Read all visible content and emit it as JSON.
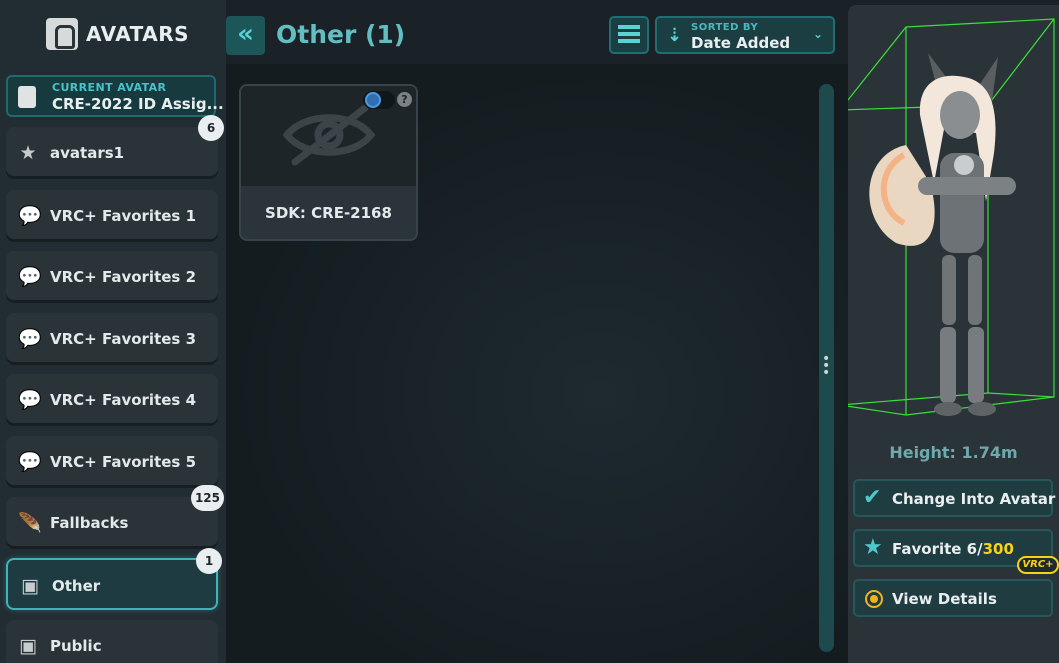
{
  "app": {
    "title": "AVATARS"
  },
  "current_avatar": {
    "label": "CURRENT AVATAR",
    "name": "CRE-2022 ID Assig..."
  },
  "sidebar": {
    "items": [
      {
        "label": "avatars1",
        "icon": "star-icon",
        "badge": "6",
        "selected": false
      },
      {
        "label": "VRC+ Favorites 1",
        "icon": "chat-bubble-icon",
        "badge": "",
        "selected": false
      },
      {
        "label": "VRC+ Favorites 2",
        "icon": "chat-bubble-icon",
        "badge": "",
        "selected": false
      },
      {
        "label": "VRC+ Favorites 3",
        "icon": "chat-bubble-icon",
        "badge": "",
        "selected": false
      },
      {
        "label": "VRC+ Favorites 4",
        "icon": "chat-bubble-icon",
        "badge": "",
        "selected": false
      },
      {
        "label": "VRC+ Favorites 5",
        "icon": "chat-bubble-icon",
        "badge": "",
        "selected": false
      },
      {
        "label": "Fallbacks",
        "icon": "feather-icon",
        "badge": "125",
        "selected": false
      },
      {
        "label": "Other",
        "icon": "avatar-book-icon",
        "badge": "1",
        "selected": true
      },
      {
        "label": "Public",
        "icon": "avatar-book-icon",
        "badge": "",
        "selected": false
      }
    ]
  },
  "header": {
    "collapse_icon": "double-chevron-left-icon",
    "title": "Other (1)",
    "view_icon": "list-view-icon",
    "sort_label": "SORTED BY",
    "sort_value": "Date Added"
  },
  "cards": [
    {
      "title": "SDK: CRE-2168",
      "thumbnail_icon": "hidden-eye-icon",
      "help": "?"
    }
  ],
  "preview": {
    "height_text": "Height: 1.74m"
  },
  "actions": {
    "change": "Change Into Avatar",
    "favorite_prefix": "Favorite 6/",
    "favorite_limit": "300",
    "vrcplus": "VRC+",
    "details": "View Details"
  },
  "colors": {
    "accent": "#4fc8cc",
    "highlight": "#f7d21a",
    "bounding_box": "#39e03a"
  }
}
